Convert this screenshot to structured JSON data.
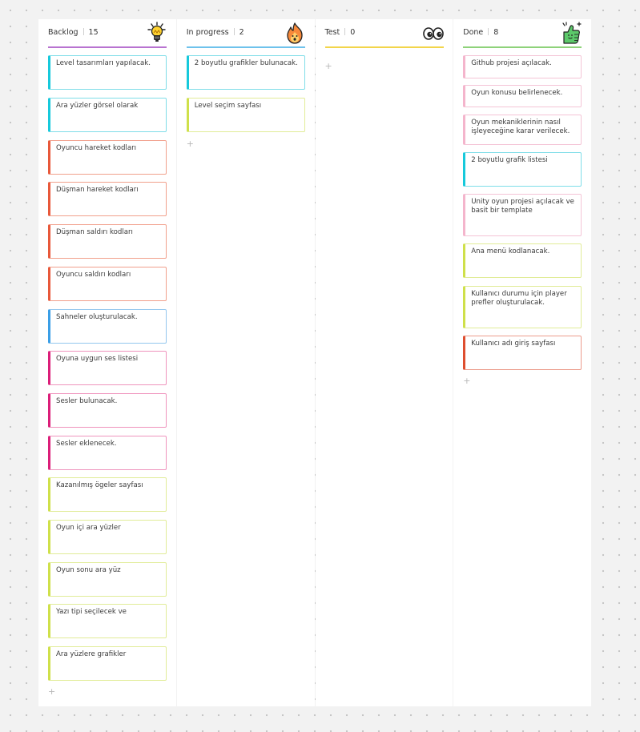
{
  "columns": [
    {
      "title": "Backlog",
      "count": "15",
      "emoji": "lightbulb-emoji",
      "accent": "#b873d0",
      "cards": [
        {
          "text": "Level tasarımları yapılacak.",
          "color": "cyan"
        },
        {
          "text": "Ara yüzler görsel olarak",
          "color": "cyan"
        },
        {
          "text": "Oyuncu hareket kodları",
          "color": "orange"
        },
        {
          "text": "Düşman hareket kodları",
          "color": "orange"
        },
        {
          "text": "Düşman saldırı kodları",
          "color": "orange"
        },
        {
          "text": "Oyuncu saldırı kodları",
          "color": "orange"
        },
        {
          "text": "Sahneler oluşturulacak.",
          "color": "blue"
        },
        {
          "text": "Oyuna uygun ses listesi",
          "color": "magenta"
        },
        {
          "text": "Sesler bulunacak.",
          "color": "magenta"
        },
        {
          "text": "Sesler eklenecek.",
          "color": "magenta"
        },
        {
          "text": "Kazanılmış ögeler sayfası",
          "color": "lime"
        },
        {
          "text": "Oyun içi ara yüzler",
          "color": "lime"
        },
        {
          "text": "Oyun sonu ara yüz",
          "color": "lime"
        },
        {
          "text": "Yazı tipi seçilecek ve",
          "color": "lime"
        },
        {
          "text": "Ara yüzlere grafikler",
          "color": "lime"
        }
      ]
    },
    {
      "title": "In progress",
      "count": "2",
      "emoji": "fire-emoji",
      "accent": "#6ec2ec",
      "cards": [
        {
          "text": "2 boyutlu grafikler bulunacak.",
          "color": "cyan"
        },
        {
          "text": "Level seçim sayfası",
          "color": "lime"
        }
      ]
    },
    {
      "title": "Test",
      "count": "0",
      "emoji": "eyes-emoji",
      "accent": "#f2d54a",
      "cards": []
    },
    {
      "title": "Done",
      "count": "8",
      "emoji": "thumbs-up-emoji",
      "accent": "#8ed27a",
      "cards": [
        {
          "text": "Github projesi açılacak.",
          "color": "pink"
        },
        {
          "text": "Oyun konusu belirlenecek.",
          "color": "pink"
        },
        {
          "text": "Oyun mekaniklerinin nasıl işleyeceğine karar verilecek.",
          "color": "pink"
        },
        {
          "text": "2 boyutlu grafik listesi",
          "color": "cyan"
        },
        {
          "text": "Unity oyun projesi açılacak ve basit bir template",
          "color": "pink"
        },
        {
          "text": "Ana menü kodlanacak.",
          "color": "lime"
        },
        {
          "text": "Kullanıcı durumu için player prefler oluşturulacak.",
          "color": "lime"
        },
        {
          "text": "Kullanıcı adı giriş sayfası",
          "color": "red"
        }
      ]
    }
  ],
  "add_card_symbol": "+"
}
